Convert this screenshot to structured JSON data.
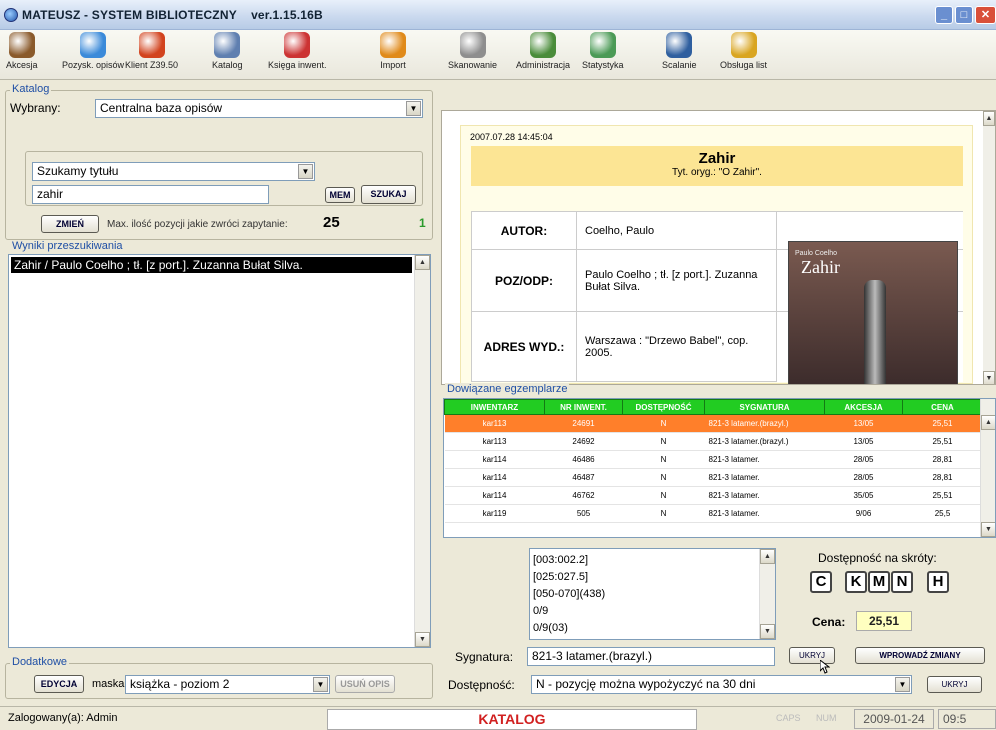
{
  "window": {
    "title": "MATEUSZ - SYSTEM BIBLIOTECZNY",
    "version": "ver.1.15.16B"
  },
  "toolbar": [
    {
      "label": "Akcesja",
      "icon": "accession-icon",
      "color": "#8a5a2b"
    },
    {
      "label": "Pozysk. opisów",
      "icon": "globe-icon",
      "color": "#3b8ad9"
    },
    {
      "label": "Klient Z39.50",
      "icon": "network-client-icon",
      "color": "#d2431e"
    },
    {
      "label": "Katalog",
      "icon": "magnifier-icon",
      "color": "#5f7fb0"
    },
    {
      "label": "Księga inwent.",
      "icon": "inventory-book-icon",
      "color": "#cc3333"
    },
    {
      "label": "Import",
      "icon": "import-icon",
      "color": "#e08a1a"
    },
    {
      "label": "Skanowanie",
      "icon": "scanner-icon",
      "color": "#8e8e8e"
    },
    {
      "label": "Administracja",
      "icon": "admin-gears-icon",
      "color": "#4a8c3a"
    },
    {
      "label": "Statystyka",
      "icon": "statistics-icon",
      "color": "#4b9a56"
    },
    {
      "label": "Scalanie",
      "icon": "merge-icon",
      "color": "#2f5f9f"
    },
    {
      "label": "Obsługa list",
      "icon": "lists-icon",
      "color": "#d9a521"
    }
  ],
  "catalog": {
    "group_label": "Katalog",
    "selected_label": "Wybrany:",
    "selected_value": "Centralna baza opisów",
    "search_type": "Szukamy tytułu",
    "query": "zahir",
    "mem_label": "MEM",
    "search_label": "SZUKAJ",
    "change_label": "ZMIEŃ",
    "max_text": "Max. ilość pozycji jakie zwróci zapytanie:",
    "max_value": "25",
    "result_count": "1"
  },
  "results": {
    "group_label": "Wyniki przeszukiwania",
    "items": [
      "Zahir / Paulo Coelho ; tł. [z port.]. Zuzanna Bułat Silva."
    ]
  },
  "extras": {
    "group_label": "Dodatkowe",
    "edit_label": "EDYCJA",
    "mask_label": "maska:",
    "mask_value": "książka - poziom 2",
    "delete_label": "USUŃ OPIS"
  },
  "record": {
    "timestamp": "2007.07.28 14:45:04",
    "title": "Zahir",
    "original_title": "Tyt. oryg.: \"O Zahir\".",
    "rows": [
      {
        "label": "AUTOR:",
        "value": "Coelho, Paulo"
      },
      {
        "label": "POZ/ODP:",
        "value": "Paulo Coelho ; tł. [z port.]. Zuzanna Bułat Silva."
      },
      {
        "label": "ADRES WYD.:",
        "value": "Warszawa : \"Drzewo Babel\", cop. 2005."
      }
    ],
    "cover_author": "Paulo Coelho",
    "cover_title": "Zahir"
  },
  "copies": {
    "group_label": "Dowiązane egzemplarze",
    "columns": [
      "INWENTARZ",
      "NR INWENT.",
      "DOSTĘPNOŚĆ",
      "SYGNATURA",
      "AKCESJA",
      "CENA"
    ],
    "rows": [
      [
        "kar113",
        "24691",
        "N",
        "821-3 latamer.(brazyl.)",
        "13/05",
        "25,51"
      ],
      [
        "kar113",
        "24692",
        "N",
        "821-3 latamer.(brazyl.)",
        "13/05",
        "25,51"
      ],
      [
        "kar114",
        "46486",
        "N",
        "821-3 latamer.",
        "28/05",
        "28,81"
      ],
      [
        "kar114",
        "46487",
        "N",
        "821-3 latamer.",
        "28/05",
        "28,81"
      ],
      [
        "kar114",
        "46762",
        "N",
        "821-3 latamer.",
        "35/05",
        "25,51"
      ],
      [
        "kar119",
        "505",
        "N",
        "821-3 latamer.",
        "9/06",
        "25,5"
      ]
    ]
  },
  "details": {
    "codes": [
      "[003:002.2]",
      "[025:027.5]",
      "[050-070](438)",
      "0/9",
      "0/9(03)"
    ],
    "shortcut_label": "Dostępność na skróty:",
    "shortcuts": [
      "C",
      "K",
      "M",
      "N",
      "H"
    ],
    "price_label": "Cena:",
    "price_value": "25,51",
    "signature_label": "Sygnatura:",
    "signature_value": "821-3 latamer.(brazyl.)",
    "hide_label": "UKRYJ",
    "apply_label": "WPROWADŹ ZMIANY",
    "availability_label": "Dostępność:",
    "availability_value": "N - pozycję można wypożyczyć na 30 dni",
    "hide2_label": "UKRYJ"
  },
  "status": {
    "user": "Zalogowany(a): Admin",
    "module": "KATALOG",
    "caps": "CAPS",
    "num": "NUM",
    "date": "2009-01-24",
    "time": "09:5"
  }
}
